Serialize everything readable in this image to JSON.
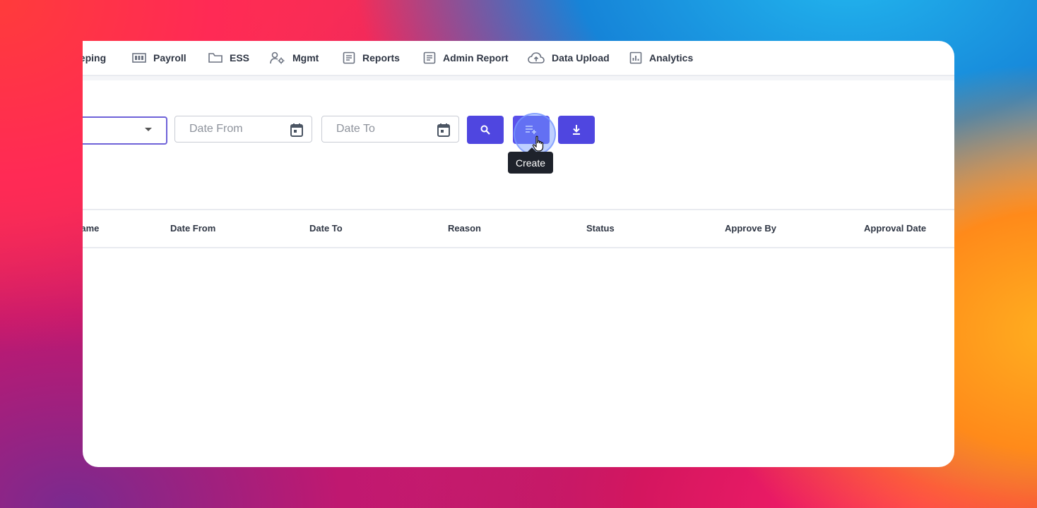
{
  "nav": {
    "items": [
      {
        "label": "eeping",
        "icon": "clock-icon"
      },
      {
        "label": "Payroll",
        "icon": "payroll-icon"
      },
      {
        "label": "ESS",
        "icon": "folder-icon"
      },
      {
        "label": "Mgmt",
        "icon": "user-gear-icon"
      },
      {
        "label": "Reports",
        "icon": "document-icon"
      },
      {
        "label": "Admin Report",
        "icon": "document-icon"
      },
      {
        "label": "Data Upload",
        "icon": "cloud-upload-icon"
      },
      {
        "label": "Analytics",
        "icon": "chart-icon"
      }
    ]
  },
  "filters": {
    "select_value": "",
    "date_from_placeholder": "Date From",
    "date_to_placeholder": "Date To",
    "create_tooltip": "Create"
  },
  "table": {
    "columns": [
      "Name",
      "Date From",
      "Date To",
      "Reason",
      "Status",
      "Approve By",
      "Approval Date"
    ],
    "rows": []
  },
  "colors": {
    "accent": "#4f46e0",
    "tooltip_bg": "#1e222b"
  }
}
